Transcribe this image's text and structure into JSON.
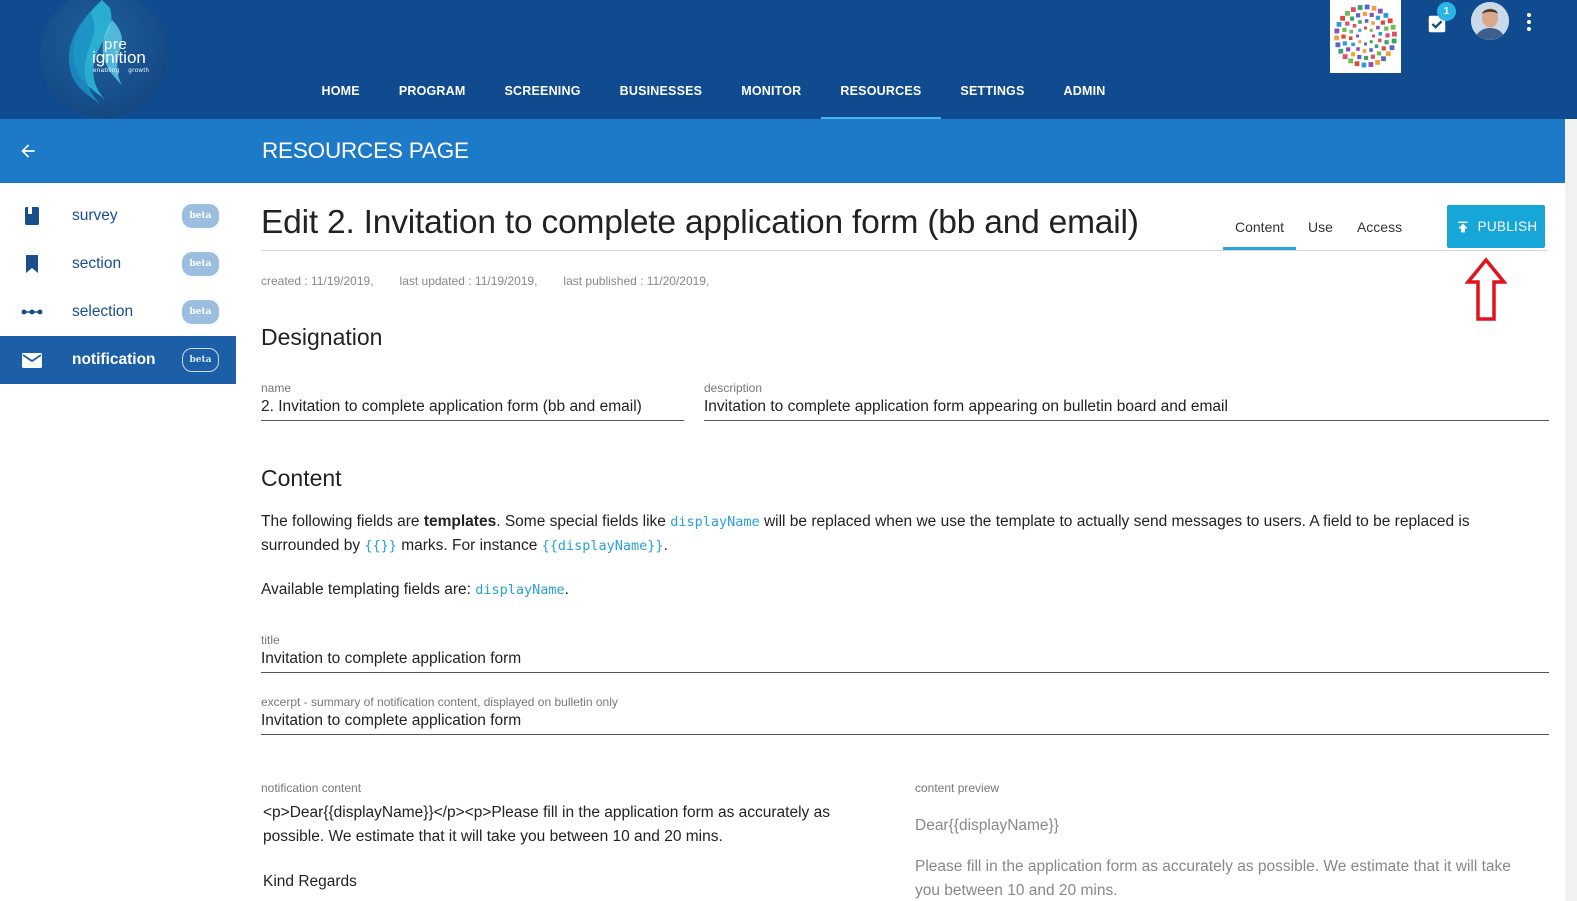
{
  "app": {
    "logo": {
      "line1": "pre",
      "line2": "ignition",
      "line3": "enabling    growth"
    },
    "nav": [
      {
        "label": "HOME"
      },
      {
        "label": "PROGRAM"
      },
      {
        "label": "SCREENING"
      },
      {
        "label": "BUSINESSES"
      },
      {
        "label": "MONITOR"
      },
      {
        "label": "RESOURCES",
        "active": true
      },
      {
        "label": "SETTINGS"
      },
      {
        "label": "ADMIN"
      }
    ],
    "notifications_count": "1"
  },
  "subheader": {
    "title": "RESOURCES PAGE"
  },
  "sidebar": {
    "items": [
      {
        "label": "survey",
        "badge": "beta",
        "icon": "book-icon"
      },
      {
        "label": "section",
        "badge": "beta",
        "icon": "bookmark-icon"
      },
      {
        "label": "selection",
        "badge": "beta",
        "icon": "dots-line-icon"
      },
      {
        "label": "notification",
        "badge": "beta",
        "icon": "mail-icon",
        "active": true
      }
    ]
  },
  "editor": {
    "title": "Edit 2. Invitation to complete application form (bb and email)",
    "tabs": [
      {
        "label": "Content",
        "active": true
      },
      {
        "label": "Use"
      },
      {
        "label": "Access"
      }
    ],
    "publish_label": "PUBLISH",
    "meta": {
      "created": "created : 11/19/2019,",
      "last_updated": "last updated : 11/19/2019,",
      "last_published": "last published : 11/20/2019,"
    },
    "designation": {
      "heading": "Designation",
      "name_label": "name",
      "name_value": "2.  Invitation to complete application form (bb and email)",
      "description_label": "description",
      "description_value": "Invitation to complete application form appearing on bulletin board and email"
    },
    "content": {
      "heading": "Content",
      "intro_1": "The following fields are ",
      "intro_bold": "templates",
      "intro_2": ". Some special fields like ",
      "intro_code1": "displayName",
      "intro_3": " will be replaced when we use the template to actually send messages to users. A field to be replaced is surrounded by ",
      "intro_code2": "{{}}",
      "intro_4": " marks. For instance ",
      "intro_code3": "{{displayName}}",
      "intro_5": ".",
      "available_1": "Available templating fields are: ",
      "available_code": "displayName",
      "available_2": ".",
      "title_label": "title",
      "title_value": "Invitation to complete application form",
      "excerpt_label": "excerpt - summary of notification content, displayed on bulletin only",
      "excerpt_value": "Invitation to complete application form",
      "notification_label": "notification content",
      "notification_text": "<p>Dear{{displayName}}</p><p>Please fill in the application form as accurately as possible.  We estimate that it will take you between 10 and 20 mins.",
      "notification_text2": "Kind Regards",
      "preview_label": "content preview",
      "preview_line1": "Dear{{displayName}}",
      "preview_line2": "Please fill in the application form as accurately as possible. We estimate that it will take you between 10 and 20 mins."
    }
  },
  "colors": {
    "topbar": "#114b8f",
    "subbar": "#1d7ac8",
    "accent": "#16a6d8",
    "sidebar_active": "#1c5fa6",
    "annotation_arrow": "#e0141e"
  }
}
